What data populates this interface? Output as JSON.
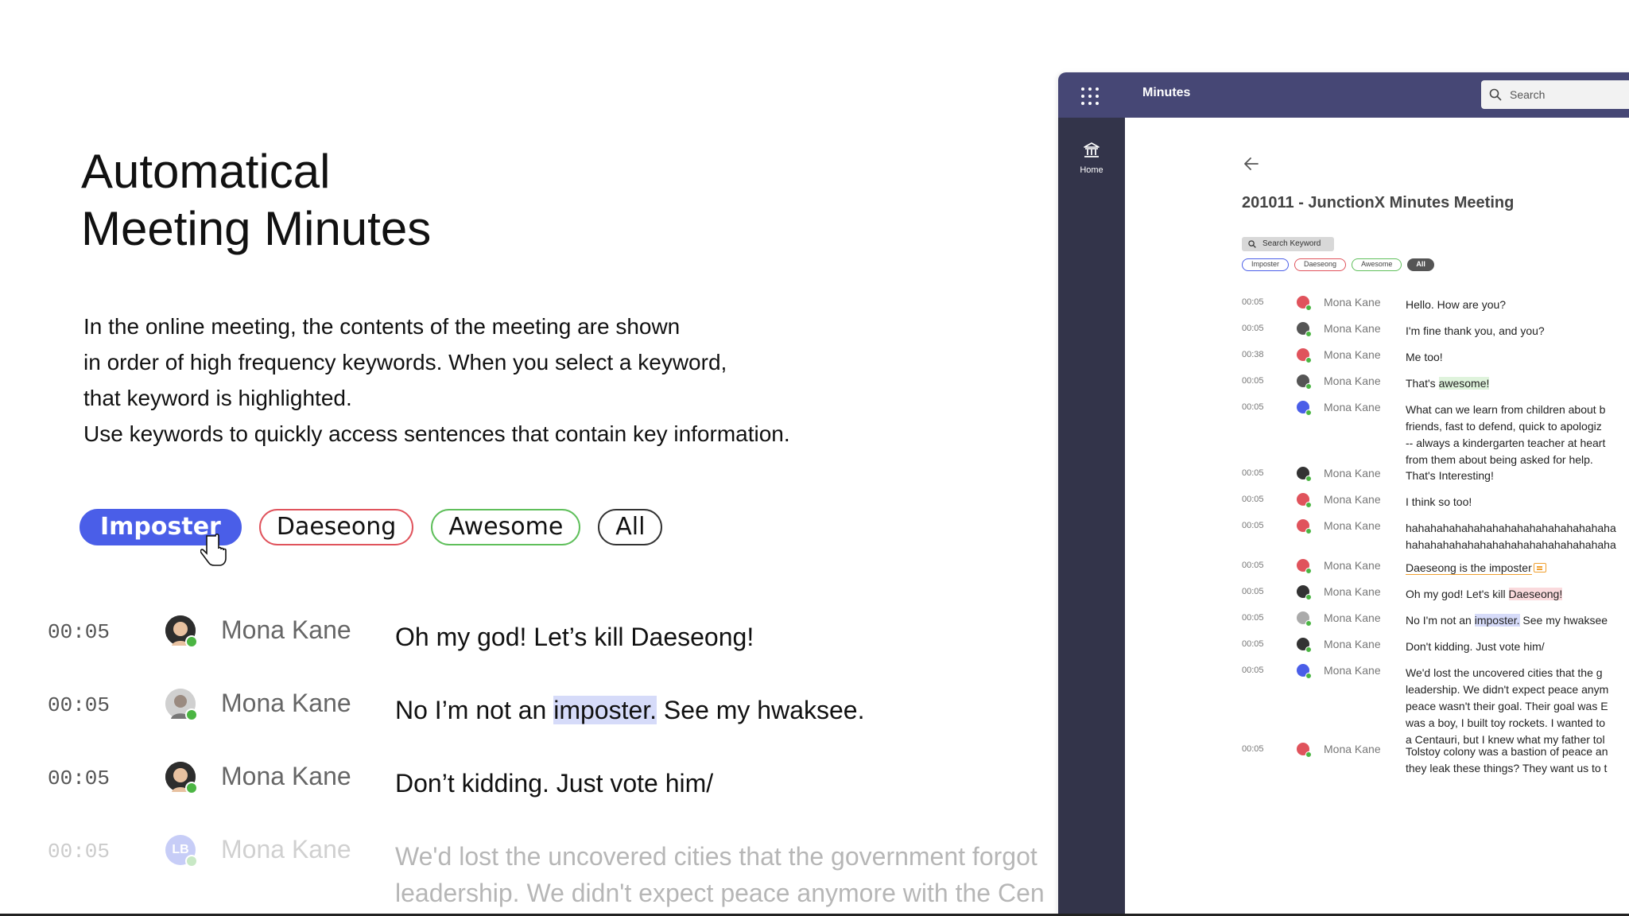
{
  "hero": {
    "title_line1": "Automatical",
    "title_line2": "Meeting Minutes",
    "desc": [
      "In the online meeting, the contents of the meeting are shown",
      "in order of high frequency keywords. When you select a keyword,",
      "that keyword is highlighted.",
      "Use keywords to quickly access sentences that contain key information."
    ]
  },
  "keywords": {
    "imposter": "Imposter",
    "daeseong": "Daeseong",
    "awesome": "Awesome",
    "all": "All"
  },
  "big_rows": [
    {
      "time": "00:05",
      "name": "Mona Kane",
      "msg": "Oh my god! Let’s kill Daeseong!"
    },
    {
      "time": "00:05",
      "name": "Mona Kane",
      "msg_pre": "No I’m not an ",
      "msg_hl": "imposter.",
      "msg_post": " See my hwaksee."
    },
    {
      "time": "00:05",
      "name": "Mona Kane",
      "msg": "Don’t kidding. Just vote him/"
    },
    {
      "time": "00:05",
      "name": "Mona Kane",
      "avatar_initials": "LB",
      "msg_line1": "We'd lost the uncovered cities that the government forgot",
      "msg_line2": "leadership. We didn't expect peace anymore with the Cen"
    }
  ],
  "app": {
    "title": "Minutes",
    "search_placeholder": "Search",
    "rail_home": "Home",
    "meeting_title": "201011 - JunctionX Minutes Meeting",
    "search_keyword": "Search Keyword",
    "chips": [
      "Imposter",
      "Daeseong",
      "Awesome",
      "All"
    ],
    "rows": [
      {
        "time": "00:05",
        "name": "Mona Kane",
        "msg": "Hello. How are you?"
      },
      {
        "time": "00:05",
        "name": "Mona Kane",
        "msg": "I'm fine thank you, and you?"
      },
      {
        "time": "00:38",
        "name": "Mona Kane",
        "msg": "Me too!"
      },
      {
        "time": "00:05",
        "name": "Mona Kane",
        "msg_pre": "That's ",
        "msg_hl": "awesome!"
      },
      {
        "time": "00:05",
        "name": "Mona Kane",
        "msg": "What can we learn from children about b\nfriends, fast to defend, quick to apologiz\n-- always a kindergarten teacher at heart\nfrom them about being asked for help."
      },
      {
        "time": "00:05",
        "name": "Mona Kane",
        "msg": "That's Interesting!"
      },
      {
        "time": "00:05",
        "name": "Mona Kane",
        "msg": "I think so too!"
      },
      {
        "time": "00:05",
        "name": "Mona Kane",
        "msg": "hahahahahahahahahahahahahahahahaha\nhahahahahahahahahahahahahahahahaha"
      },
      {
        "time": "00:05",
        "name": "Mona Kane",
        "msg": "Daeseong is the imposter"
      },
      {
        "time": "00:05",
        "name": "Mona Kane",
        "msg_pre": "Oh my god! Let's kill ",
        "msg_hl": "Daeseong!"
      },
      {
        "time": "00:05",
        "name": "Mona Kane",
        "msg_pre": "No I'm not an ",
        "msg_hl": "imposter.",
        "msg_post": " See my hwaksee"
      },
      {
        "time": "00:05",
        "name": "Mona Kane",
        "msg": "Don't kidding. Just vote him/"
      },
      {
        "time": "00:05",
        "name": "Mona Kane",
        "msg": "We'd lost the uncovered cities that the g\nleadership. We didn't expect peace anym\npeace wasn't their goal. Their goal was E\nwas a boy, I built toy rockets. I wanted to\na Centauri, but I knew what my father tol"
      },
      {
        "time": "00:05",
        "name": "Mona Kane",
        "msg": "Tolstoy colony was a bastion of peace an\nthey leak these things? They want us to t"
      }
    ]
  },
  "colors": {
    "accent_blue": "#4a5ee8",
    "red": "#e0535c",
    "green": "#5fbf5b",
    "teams_purple": "#464775",
    "rail": "#33344a"
  }
}
